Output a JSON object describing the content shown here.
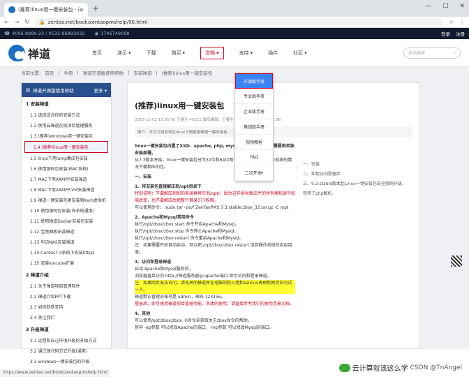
{
  "browser": {
    "tab_title": "(推荐)linux用一键安装包 - 禅道",
    "url": "zentao.net/book/zentaopmshelp/90.html"
  },
  "topbar": {
    "phone": "4006-8899-23 / 0532-86893032",
    "qq": "1746749098",
    "login": "登录",
    "register": "注册"
  },
  "logo_text": "禅道",
  "nav": [
    "首页",
    "演示",
    "下载",
    "购买",
    "文档",
    "支持",
    "插件",
    "社区"
  ],
  "nav_active": "文档",
  "search_placeholder": "全站搜索",
  "breadcrumb": [
    "当前位置:",
    "首页",
    "手册",
    "禅道开源版使用帮助",
    "安装禅道",
    "(推荐)linux用一键安装包"
  ],
  "sidebar": {
    "title": "禅道开源版使用帮助",
    "more": "更多",
    "sec1": "1 安装禅道",
    "items1": [
      "1.1 选择适合你的安装方法",
      "1.2 使用云禅道在线项目管理服务",
      "1.3 (推荐)windows用一键安装包",
      "1.4 (推荐)linux用一键安装包",
      "1.5 linux下用lamp集成包安装",
      "1.6 使用源码包安装(MAC系统)",
      "1.7 MAC下用XAMPP安装禅道",
      "1.8 MAC下用XAMPP-VM安装禅道",
      "1.9 禅道一键安装包更安装到Kvm虚拟机",
      "1.10 使用源码包安装(各系统通用)",
      "1.11 使用禅道Docker安装包安装",
      "1.12 宝塔面板安装禅道",
      "1.13 华迈NAS安装禅道",
      "1.14 Centos7.4系统下安装httpd",
      "1.15 安装ioncube扩展"
    ],
    "sec2": "2 禅道介绍",
    "items2": [
      "2.1 关于禅道项目管理软件",
      "2.2 禅道介绍PPT下载",
      "2.3 如何获得支持",
      "2.4 关注我们"
    ],
    "sec3": "3 升级禅道",
    "items3": [
      "3.1 远程和自己环境升级的升级方式",
      "3.2 通过源代码方式升级(通用)",
      "3.3 windows一键安装包的升级"
    ]
  },
  "article": {
    "title": "(推荐)linux用一键安装包",
    "meta": "2015-11-02 15:05:00  王春生  45221  最后编辑：王春生 于 2018-06-03 09:52:36",
    "summary": "简介：本文介绍如何在linux下面使用禅道一键安装包...",
    "intro": "linux一键安装包内置了XXD、apache, php, mysql这些运行程序。不需要再单独安装部署。",
    "intro2": "从7.3版本开始，linux一键安装包分为32位和64位两个包，请大家根据操作系统的情况下载相应的包。",
    "h1": "一、安装",
    "h11": "1、将安装包直接解压到/opt目录下",
    "note1": "特别说明：不要解压到别的目录再拷贝到/opt/，因为这样会导致文件的所有者和读写权限改变，也不要解压后把整个目录777权限。",
    "cmd1": "可以使用命令： sudo tar -zxvf ZenTaoPMS.7.3.stable.zbox_32.tar.gz -C /opt",
    "h12": "2、Apache和Mysql常用命令",
    "cmd2": "执行/opt/zbox/zbox start 命令开启Apache和Mysql。",
    "cmd3": "执行/opt/zbox/zbox stop 命令停止Apache和Mysql。",
    "cmd4": "执行/opt/zbox/zbox restart 命令重启Apache和Mysql。",
    "note2": "注：如果需要开机自动启动，可以把 /opt/zbox/zbox restart 加到操作系统的自启目录。",
    "h13": "3、访问和登录禅道",
    "step1": "启动 Apache和Mysql服务后，",
    "step2": "浏览器直接访问 http://禅道服务器ip:apache端口 即可访问和登录禅道。",
    "hl": "注：如果网页无法访问，请先关闭禅道所在电脑的防火墙和selinux再刷新网页访问试一下。",
    "step3": "禅道默认管理员帐号是 admin，密码 123456。",
    "step4": "登录后，即可使用禅道项目管理功能。具体的使用，请直接参考我们的使用手册文档。",
    "h14": "4、其他",
    "other1": "可以使用/opt/zbox/zbox -h命令来获取关于zbox命令的帮助。",
    "other2": "其中 -ap参数 可以修改Apache的端口，-mp参数 可以修改Mysql的端口。"
  },
  "toc": [
    "一、安装",
    "二、如何访问数据库",
    "三、9.2.stable版本起Linux一键安装包安全限制升级，禁用了php解析。"
  ],
  "dropdown": [
    "开源版手册",
    "专业版手册",
    "企业版手册",
    "集团版手册",
    "视频教程",
    "FAQ",
    "二次开发"
  ],
  "status_url": "https://www.zentao.net/book/zentaopmshelp.html",
  "watermark": "云计算就该这么学",
  "watermark2": "CSDN @TnAngel"
}
